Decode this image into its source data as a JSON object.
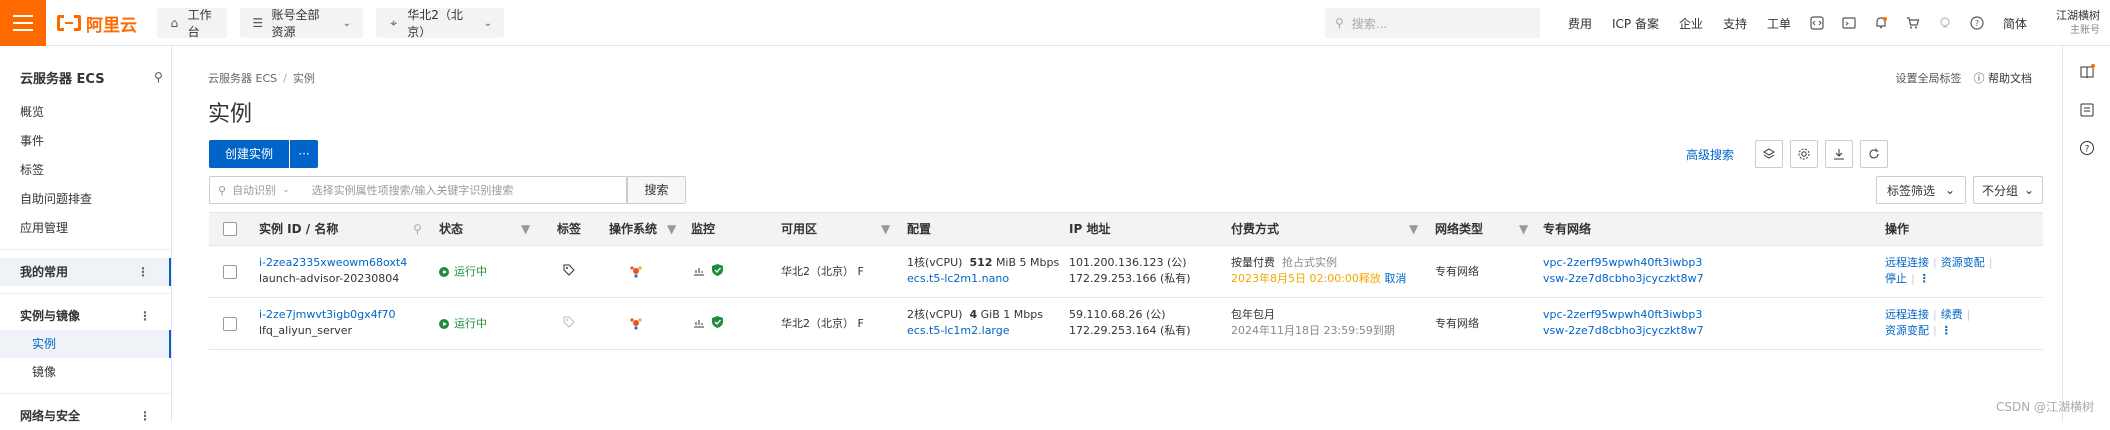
{
  "top": {
    "logo_text": "阿里云",
    "nav": [
      {
        "label": "工作台"
      },
      {
        "label": "账号全部资源"
      },
      {
        "label": "华北2（北京）"
      }
    ],
    "search_placeholder": "搜索...",
    "links": [
      "费用",
      "ICP 备案",
      "企业",
      "支持",
      "工单"
    ],
    "lang": "简体",
    "user_name": "江湖横树",
    "user_role": "主账号"
  },
  "sidebar": {
    "title": "云服务器 ECS",
    "items": [
      "概览",
      "事件",
      "标签",
      "自助问题排查",
      "应用管理"
    ],
    "group_fav": "我的常用",
    "group_inst": "实例与镜像",
    "sub_items": [
      "实例",
      "镜像"
    ],
    "group_net": "网络与安全"
  },
  "main": {
    "breadcrumb": [
      "云服务器 ECS",
      "实例"
    ],
    "title": "实例",
    "global_tag": "设置全局标签",
    "help_doc": "帮助文档",
    "create_btn": "创建实例",
    "more_btn": "···",
    "adv_search": "高级搜索",
    "filter_prefix": "自动识别",
    "filter_placeholder": "选择实例属性项搜索/输入关键字识别搜索",
    "search_btn": "搜索",
    "tag_filter": "标签筛选",
    "no_group": "不分组"
  },
  "table": {
    "headers": [
      "实例 ID / 名称",
      "状态",
      "标签",
      "操作系统",
      "监控",
      "可用区",
      "配置",
      "IP 地址",
      "付费方式",
      "网络类型",
      "专有网络",
      "操作"
    ],
    "rows": [
      {
        "id": "i-2zea2335xweowm68oxt4",
        "name": "launch-advisor-20230804",
        "status": "运行中",
        "zone": "华北2（北京） F",
        "cfg_cpu": "1核(vCPU)",
        "cfg_mem": "512",
        "cfg_mem_unit": "MiB",
        "cfg_bw": "5 Mbps",
        "cfg_type": "ecs.t5-lc2m1.nano",
        "ip_pub": "101.200.136.123 (公)",
        "ip_priv": "172.29.253.166 (私有)",
        "pay": "按量付费",
        "pay_sub": "抢占式实例",
        "pay_note": "2023年8月5日 02:00:00释放",
        "pay_action": "取消",
        "net": "专有网络",
        "vpc": "vpc-2zerf95wpwh40ft3iwbp3",
        "vsw": "vsw-2ze7d8cbho3jcyczkt8w7",
        "ops1": [
          "远程连接",
          "资源变配"
        ],
        "ops2": [
          "停止"
        ]
      },
      {
        "id": "i-2ze7jmwvt3igb0gx4f70",
        "name": "lfq_aliyun_server",
        "status": "运行中",
        "zone": "华北2（北京） F",
        "cfg_cpu": "2核(vCPU)",
        "cfg_mem": "4",
        "cfg_mem_unit": "GiB",
        "cfg_bw": "1 Mbps",
        "cfg_type": "ecs.t5-lc1m2.large",
        "ip_pub": "59.110.68.26 (公)",
        "ip_priv": "172.29.253.164 (私有)",
        "pay": "包年包月",
        "pay_sub": "",
        "pay_note": "2024年11月18日 23:59:59到期",
        "pay_action": "",
        "net": "专有网络",
        "vpc": "vpc-2zerf95wpwh40ft3iwbp3",
        "vsw": "vsw-2ze7d8cbho3jcyczkt8w7",
        "ops1": [
          "远程连接",
          "续费"
        ],
        "ops2": [
          "资源变配"
        ]
      }
    ]
  },
  "watermark": "CSDN @江湖横树",
  "colors": {
    "brand": "#ff6a00",
    "primary": "#0064c8",
    "success": "#1e8e3e",
    "warn": "#f0a800"
  }
}
